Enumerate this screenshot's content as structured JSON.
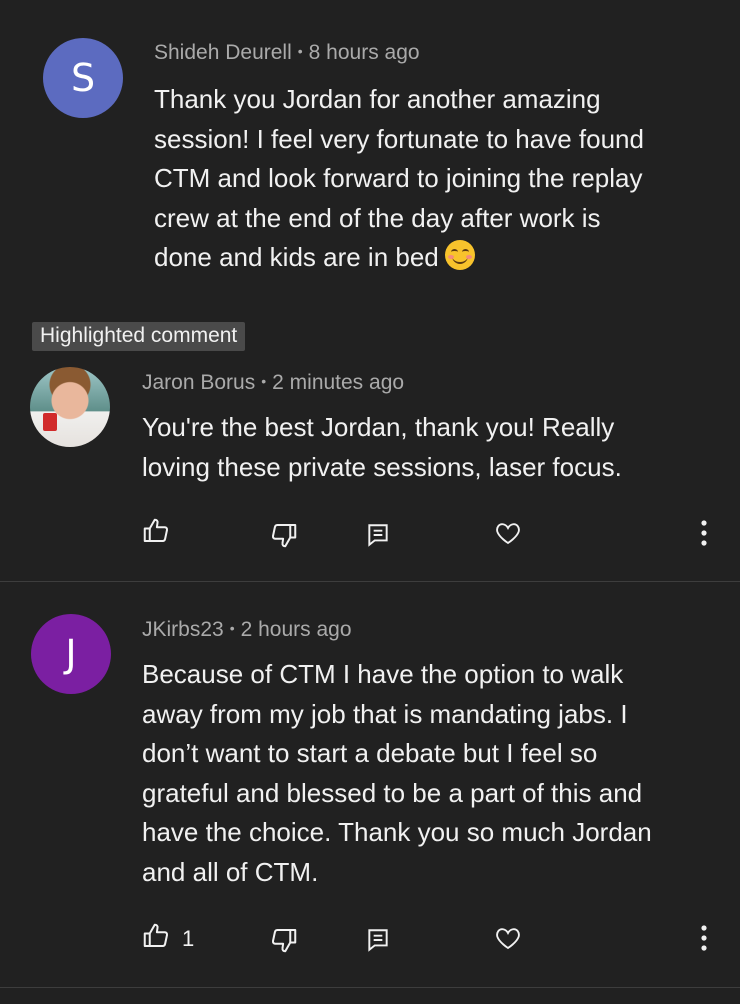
{
  "comments": [
    {
      "avatar_letter": "S",
      "avatar_color": "#5c6bc0",
      "author": "Shideh Deurell",
      "time": "8 hours ago",
      "text": "Thank you Jordan for another amazing\nsession! I feel very fortunate to have found\nCTM and look forward to joining the replay\ncrew at the end of the day after work is\ndone and kids are in bed"
    },
    {
      "badge": "Highlighted comment",
      "author": "Jaron Borus",
      "time": "2 minutes ago",
      "text": "You're the best Jordan, thank you! Really\nloving these private sessions, laser focus.",
      "like_count": ""
    },
    {
      "avatar_letter": "J",
      "avatar_color": "#7b1fa2",
      "author": "JKirbs23",
      "time": "2 hours ago",
      "text": "Because of CTM I have the option to walk\naway from my job that is mandating jabs.   I\ndon’t want to start a debate but I feel so\ngrateful and blessed to be a part of this and\nhave the choice. Thank you so much Jordan\nand all of CTM.",
      "like_count": "1"
    }
  ],
  "separator": "•",
  "icons": [
    "like-icon",
    "dislike-icon",
    "reply-icon",
    "heart-icon",
    "more-icon"
  ]
}
